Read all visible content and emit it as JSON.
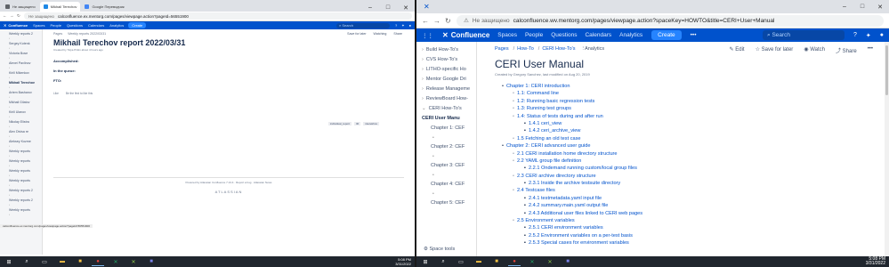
{
  "left": {
    "tabs": [
      {
        "label": "Не защищено",
        "color": "#5f6368"
      },
      {
        "label": "Mikhail Terechov",
        "color": "#1e88e5"
      },
      {
        "label": "Google Переводчик",
        "color": "#4285f4"
      }
    ],
    "url_prefix": "Не защищено",
    "url": "calconfluence.ex.mentorg.com/pages/viewpage.action?pageId=56551900",
    "nav": [
      "Spaces",
      "People",
      "Questions",
      "Calendars",
      "Analytics"
    ],
    "create": "Create",
    "logo": "Confluence",
    "search": "Search",
    "sidebar": [
      "Weekly reports 2",
      "Sergey Kotenk",
      "Victoria Bose",
      "Alexei Pavlinov",
      "Kirill Mikenkov",
      "Mikhail Terechov",
      "Artem Basharov",
      "Mikhail Gilatov",
      "Kirill Ulanov",
      "Nikolay Elistra",
      "Alex Divisa re",
      "Aleksey Kozme",
      "Weekly reports",
      "Weekly reports",
      "Weekly reports",
      "Weekly reports",
      "Weekly reports 2",
      "Weekly reports 2",
      "Weekly reports"
    ],
    "breadcrumb": [
      "Pages",
      "Weekly reports 2022/03/31"
    ],
    "actions": [
      "Save for later",
      "Watching",
      "Share"
    ],
    "title": "Mikhail Terechov report 2022/03/31",
    "meta": "Created by Tolya Prikin about 4 hours ago",
    "sections": [
      "Accomplished:",
      "In the queue:",
      "FTO:"
    ],
    "like_row": [
      "Like",
      "Be the first to like this"
    ],
    "labels": [
      "individual_report",
      "IR",
      "mterekhov"
    ],
    "footer": "Powered by Atlassian Confluence 7.13.4   ·   Report a bug   ·   Atlassian News",
    "atlassian": "ATLASSIAN",
    "statusbar": "calconfluence.ex.mentorg.com/pages/viewpage.action?pageId=56551900",
    "tooltip": "Mikhail Terechov",
    "clock_time": "5:08 PM",
    "clock_date": "3/31/2022"
  },
  "right": {
    "url_prefix": "Не защищено",
    "url": "calconfluence.wv.mentorg.com/pages/viewpage.action?spaceKey=HOWTO&title=CERI+User+Manual",
    "logo": "Confluence",
    "nav": [
      "Spaces",
      "People",
      "Questions",
      "Calendars",
      "Analytics"
    ],
    "create": "Create",
    "more": "•••",
    "search": "Search",
    "sidebar": [
      {
        "label": "Build How-To's",
        "kind": "collapsed"
      },
      {
        "label": "CVS How-To's",
        "kind": "collapsed"
      },
      {
        "label": "LITHO-specific Ho",
        "kind": "collapsed"
      },
      {
        "label": "Mentor Google Dri",
        "kind": "collapsed"
      },
      {
        "label": "Release Manageme",
        "kind": "collapsed"
      },
      {
        "label": "ReviewBoard How-",
        "kind": "collapsed"
      },
      {
        "label": "CERI How-To's",
        "kind": "expanded"
      },
      {
        "label": "CERI User Manu",
        "kind": "current"
      },
      {
        "label": "Chapter 1: CEF",
        "kind": "sub"
      },
      {
        "label": "•",
        "kind": "dot"
      },
      {
        "label": "Chapter 2: CEF",
        "kind": "sub"
      },
      {
        "label": "•",
        "kind": "dot"
      },
      {
        "label": "Chapter 3: CEF",
        "kind": "sub"
      },
      {
        "label": "•",
        "kind": "dot"
      },
      {
        "label": "Chapter 4: CEF",
        "kind": "sub"
      },
      {
        "label": "•",
        "kind": "dot"
      },
      {
        "label": "Chapter 5: CEF",
        "kind": "sub"
      }
    ],
    "space_tools": "Space tools",
    "breadcrumb": [
      "Pages",
      "How-To",
      "CERI How-To's"
    ],
    "analytics": "Analytics",
    "actions": [
      "Edit",
      "Save for later",
      "Watch",
      "Share"
    ],
    "title": "CERI User Manual",
    "meta": "Created by Gregory Sanchez, last modified on Aug 20, 2019",
    "toc": [
      {
        "level": 1,
        "text": "Chapter 1: CERI introduction"
      },
      {
        "level": 2,
        "text": "1.1: Command line"
      },
      {
        "level": 2,
        "text": "1.2: Running basic regression tests"
      },
      {
        "level": 2,
        "text": "1.3: Running test groups"
      },
      {
        "level": 2,
        "text": "1.4: Status of tests during and after run"
      },
      {
        "level": 3,
        "text": "1.4.1 ceri_view"
      },
      {
        "level": 3,
        "text": "1.4.2 ceri_archive_view"
      },
      {
        "level": 2,
        "text": "1.5 Fetching an old test case"
      },
      {
        "level": 1,
        "text": "Chapter 2: CERI advanced user guide"
      },
      {
        "level": 2,
        "text": "2.1 CERI installation home directory structure"
      },
      {
        "level": 2,
        "text": "2.2 YAML group file definition"
      },
      {
        "level": 3,
        "text": "2.2.1 Ondemand running custom/local group files"
      },
      {
        "level": 2,
        "text": "2.3 CERI archive directory structure"
      },
      {
        "level": 3,
        "text": "2.3.1 Inside the archive testsuite directory"
      },
      {
        "level": 2,
        "text": "2.4 Testcase files"
      },
      {
        "level": 3,
        "text": "2.4.1 testmetadata.yaml input file"
      },
      {
        "level": 3,
        "text": "2.4.2 summary.main.yaml output file"
      },
      {
        "level": 3,
        "text": "2.4.3 Additional user files linked to CERI web pages"
      },
      {
        "level": 2,
        "text": "2.5 Environment variables"
      },
      {
        "level": 3,
        "text": "2.5.1 CERI environment variables"
      },
      {
        "level": 3,
        "text": "2.5.2 Environment variables on a per-test basis"
      },
      {
        "level": 3,
        "text": "2.5.3 Special cases for environment variables"
      }
    ],
    "clock_time": "5:08 PM",
    "clock_date": "3/31/2022"
  },
  "taskbar_icons": [
    "windows-start",
    "search",
    "task-view",
    "file-explorer",
    "folder",
    "chrome",
    "excel",
    "app-x",
    "teams"
  ]
}
